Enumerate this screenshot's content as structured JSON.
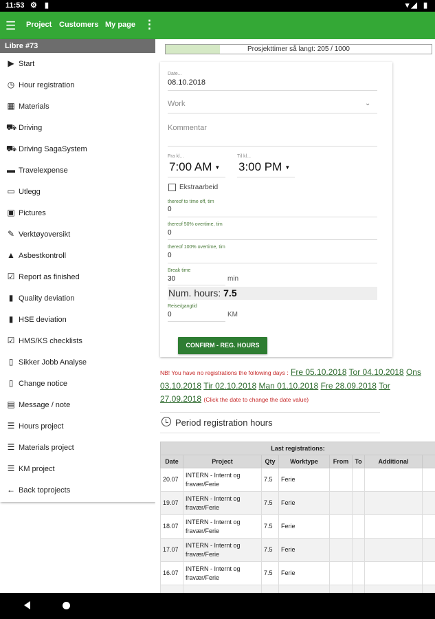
{
  "status_bar": {
    "time": "11:53",
    "left_icons": "⚙ ▮",
    "right_icons": "▾◢ ▮"
  },
  "appbar": {
    "nav": [
      "Project",
      "Customers",
      "My page"
    ]
  },
  "sidebar": {
    "project_label": "Libre #73",
    "items": [
      {
        "label": "Start",
        "icon": "play-circle-icon",
        "glyph": "▶"
      },
      {
        "label": "Hour registration",
        "icon": "clock-icon",
        "glyph": "◷"
      },
      {
        "label": "Materials",
        "icon": "materials-icon",
        "glyph": "▦"
      },
      {
        "label": "Driving",
        "icon": "car-icon",
        "glyph": "⛟"
      },
      {
        "label": "Driving SagaSystem",
        "icon": "car-icon",
        "glyph": "⛟"
      },
      {
        "label": "Travelexpense",
        "icon": "bed-icon",
        "glyph": "▬"
      },
      {
        "label": "Utlegg",
        "icon": "credit-card-icon",
        "glyph": "▭"
      },
      {
        "label": "Pictures",
        "icon": "image-icon",
        "glyph": "▣"
      },
      {
        "label": "Verktøyoversikt",
        "icon": "wrench-icon",
        "glyph": "✎"
      },
      {
        "label": "Asbestkontroll",
        "icon": "warning-icon",
        "glyph": "▲"
      },
      {
        "label": "Report as finished",
        "icon": "checkbox-icon",
        "glyph": "☑"
      },
      {
        "label": "Quality deviation",
        "icon": "clipboard-alert-icon",
        "glyph": "▮"
      },
      {
        "label": "HSE deviation",
        "icon": "clipboard-alert-icon",
        "glyph": "▮"
      },
      {
        "label": "HMS/KS checklists",
        "icon": "checkbox-icon",
        "glyph": "☑"
      },
      {
        "label": "Sikker Jobb Analyse",
        "icon": "clipboard-icon",
        "glyph": "▯"
      },
      {
        "label": "Change notice",
        "icon": "clipboard-icon",
        "glyph": "▯"
      },
      {
        "label": "Message / note",
        "icon": "message-icon",
        "glyph": "▤"
      },
      {
        "label": "Hours project",
        "icon": "list-icon",
        "glyph": "☰"
      },
      {
        "label": "Materials project",
        "icon": "list-icon",
        "glyph": "☰"
      },
      {
        "label": "KM project",
        "icon": "list-icon",
        "glyph": "☰"
      },
      {
        "label": "Back toprojects",
        "icon": "arrow-left-icon",
        "glyph": "←"
      }
    ]
  },
  "progress": {
    "text": "Prosjekttimer så langt: 205 / 1000",
    "current": 205,
    "total": 1000
  },
  "form": {
    "date_label": "Date...",
    "date_value": "08.10.2018",
    "work_placeholder": "Work",
    "comment_placeholder": "Kommentar",
    "from_label": "Fra kl...",
    "from_value": "7:00 AM",
    "to_label": "Til kl...",
    "to_value": "3:00 PM",
    "extra_label": "Ekstraarbeid",
    "timeoff_label": "thereof to time off, tim",
    "timeoff_value": "0",
    "ot50_label": "thereof 50% overtime, tim",
    "ot50_value": "0",
    "ot100_label": "thereof 100% overtime, tim",
    "ot100_value": "0",
    "break_label": "Break time",
    "break_value": "30",
    "break_unit": "min",
    "num_hours_label": "Num. hours:",
    "num_hours_value": "7.5",
    "travel_label": "Reise/gangtid",
    "travel_value": "0",
    "travel_unit": "KM",
    "confirm_label": "CONFIRM - REG. HOURS"
  },
  "notice": {
    "prefix": "NB! You have no registrations the following days :",
    "dates": [
      "Fre 05.10.2018",
      "Tor 04.10.2018",
      "Ons 03.10.2018",
      "Tir 02.10.2018",
      "Man 01.10.2018",
      "Fre 28.09.2018",
      "Tor 27.09.2018"
    ],
    "suffix": "(Click the date to change the date value)"
  },
  "period_title": "Period registration hours",
  "last_reg": {
    "title": "Last registrations:",
    "columns": [
      "Date",
      "Project",
      "Qty",
      "Worktype",
      "From",
      "To",
      "Additional",
      ""
    ],
    "rows": [
      [
        "20.07",
        "INTERN - Internt og fravær/Ferie",
        "7.5",
        "Ferie",
        "",
        "",
        "",
        ""
      ],
      [
        "19.07",
        "INTERN - Internt og fravær/Ferie",
        "7.5",
        "Ferie",
        "",
        "",
        "",
        ""
      ],
      [
        "18.07",
        "INTERN - Internt og fravær/Ferie",
        "7.5",
        "Ferie",
        "",
        "",
        "",
        ""
      ],
      [
        "17.07",
        "INTERN - Internt og fravær/Ferie",
        "7.5",
        "Ferie",
        "",
        "",
        "",
        ""
      ],
      [
        "16.07",
        "INTERN - Internt og fravær/Ferie",
        "7.5",
        "Ferie",
        "",
        "",
        "",
        ""
      ],
      [
        "",
        "INTERN - Internt og",
        "",
        "",
        "",
        "",
        "",
        ""
      ]
    ]
  }
}
